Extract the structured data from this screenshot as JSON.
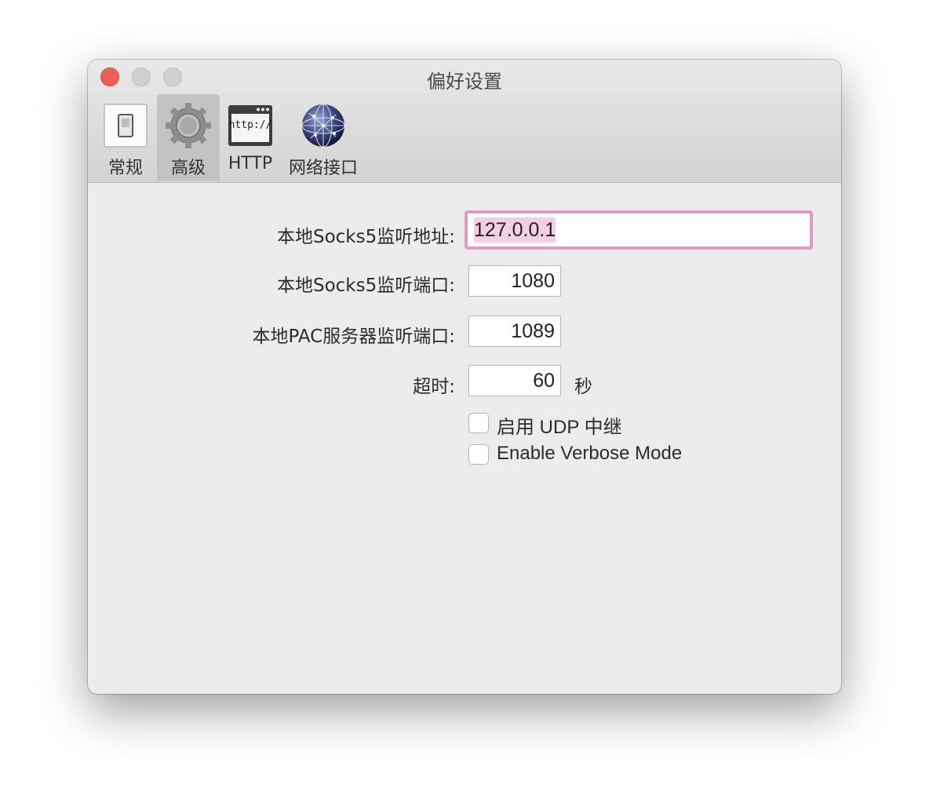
{
  "window": {
    "title": "偏好设置"
  },
  "toolbar": {
    "tabs": [
      {
        "label": "常规",
        "icon": "switch-icon",
        "selected": false
      },
      {
        "label": "高级",
        "icon": "gear-icon",
        "selected": true
      },
      {
        "label": "HTTP",
        "icon": "http-window-icon",
        "selected": false
      },
      {
        "label": "网络接口",
        "icon": "network-globe-icon",
        "selected": false
      }
    ]
  },
  "form": {
    "socks5_address_label": "本地Socks5监听地址:",
    "socks5_address_value": "127.0.0.1",
    "socks5_port_label": "本地Socks5监听端口:",
    "socks5_port_value": "1080",
    "pac_port_label": "本地PAC服务器监听端口:",
    "pac_port_value": "1089",
    "timeout_label": "超时:",
    "timeout_value": "60",
    "timeout_unit": "秒",
    "udp_relay_label": "启用 UDP 中继",
    "udp_relay_checked": false,
    "verbose_label": "Enable Verbose Mode",
    "verbose_checked": false
  },
  "colors": {
    "focus_ring": "#e39ac0",
    "selection": "#f4cfe2",
    "close_button": "#ec5f57"
  }
}
